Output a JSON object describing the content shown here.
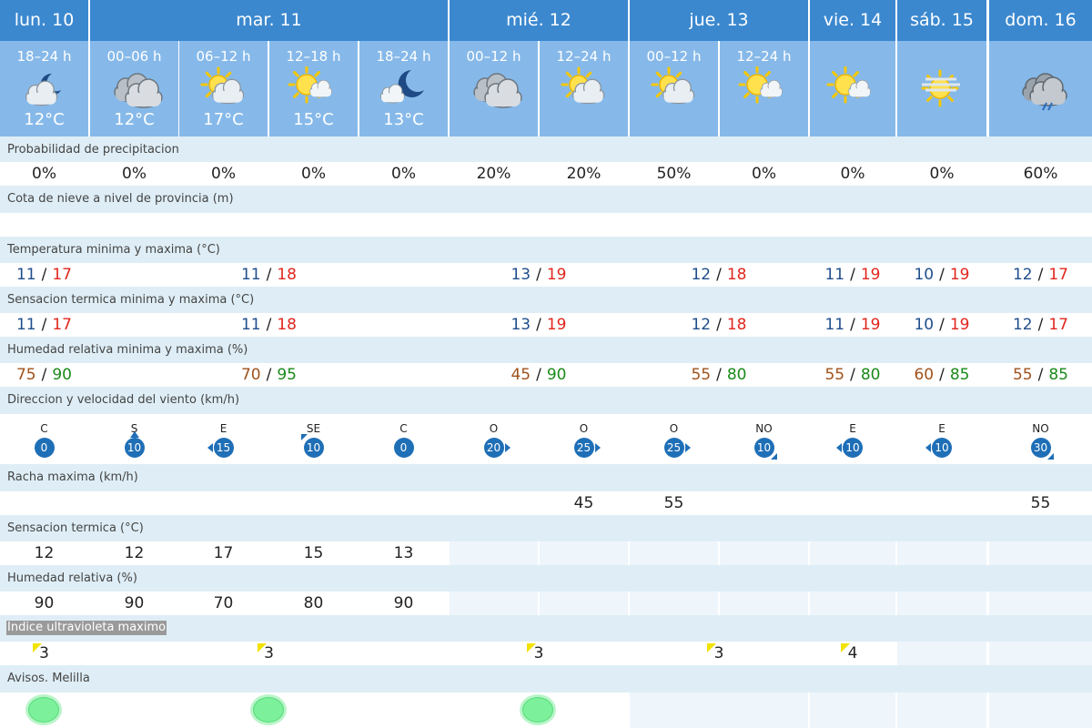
{
  "days": [
    "lun. 10",
    "mar. 11",
    "mié. 12",
    "jue. 13",
    "vie. 14",
    "sáb. 15",
    "dom. 16"
  ],
  "periods": [
    {
      "time": "18–24 h",
      "icon": "partly-cloudy-night-icon",
      "temp": "12°C"
    },
    {
      "time": "00–06 h",
      "icon": "cloudy-icon",
      "temp": "12°C"
    },
    {
      "time": "06–12 h",
      "icon": "partly-cloudy-day-icon",
      "temp": "17°C"
    },
    {
      "time": "12–18 h",
      "icon": "sun-few-clouds-icon",
      "temp": "15°C"
    },
    {
      "time": "18–24 h",
      "icon": "moon-cloud-icon",
      "temp": "13°C"
    },
    {
      "time": "00–12 h",
      "icon": "cloudy-icon",
      "temp": ""
    },
    {
      "time": "12–24 h",
      "icon": "partly-cloudy-day-icon",
      "temp": ""
    },
    {
      "time": "00–12 h",
      "icon": "partly-cloudy-day-icon",
      "temp": ""
    },
    {
      "time": "12–24 h",
      "icon": "sun-few-clouds-icon",
      "temp": ""
    },
    {
      "time": "",
      "icon": "sun-few-clouds-icon",
      "temp": ""
    },
    {
      "time": "",
      "icon": "sun-haze-icon",
      "temp": ""
    },
    {
      "time": "",
      "icon": "cloud-rain-icon",
      "temp": ""
    }
  ],
  "labels": {
    "precip": "Probabilidad de precipitacion",
    "snow": "Cota de nieve a nivel de provincia (m)",
    "temp": "Temperatura minima y maxima (°C)",
    "feels": "Sensacion termica minima y maxima (°C)",
    "humidity": "Humedad relativa minima y maxima (%)",
    "wind": "Direccion y velocidad del viento (km/h)",
    "gust": "Racha maxima (km/h)",
    "feels_single": "Sensacion termica (°C)",
    "humidity_single": "Humedad relativa (%)",
    "uv": "Indice ultravioleta maximo",
    "avisos": "Avisos. Melilla"
  },
  "precip": [
    "0%",
    "0%",
    "0%",
    "0%",
    "0%",
    "20%",
    "20%",
    "50%",
    "0%",
    "0%",
    "0%",
    "60%"
  ],
  "slash": "/",
  "temp": [
    {
      "min": "11",
      "max": "17"
    },
    {
      "min": "11",
      "max": "18"
    },
    {
      "min": "13",
      "max": "19"
    },
    {
      "min": "12",
      "max": "18"
    },
    {
      "min": "11",
      "max": "19"
    },
    {
      "min": "10",
      "max": "19"
    },
    {
      "min": "12",
      "max": "17"
    }
  ],
  "feels": [
    {
      "min": "11",
      "max": "17"
    },
    {
      "min": "11",
      "max": "18"
    },
    {
      "min": "13",
      "max": "19"
    },
    {
      "min": "12",
      "max": "18"
    },
    {
      "min": "11",
      "max": "19"
    },
    {
      "min": "10",
      "max": "19"
    },
    {
      "min": "12",
      "max": "17"
    }
  ],
  "humidity": [
    {
      "min": "75",
      "max": "90"
    },
    {
      "min": "70",
      "max": "95"
    },
    {
      "min": "45",
      "max": "90"
    },
    {
      "min": "55",
      "max": "80"
    },
    {
      "min": "55",
      "max": "80"
    },
    {
      "min": "60",
      "max": "85"
    },
    {
      "min": "55",
      "max": "85"
    }
  ],
  "wind": [
    {
      "dir": "C",
      "speed": "0",
      "arrow": "none"
    },
    {
      "dir": "S",
      "speed": "10",
      "arrow": "up"
    },
    {
      "dir": "E",
      "speed": "15",
      "arrow": "left"
    },
    {
      "dir": "SE",
      "speed": "10",
      "arrow": "up-left"
    },
    {
      "dir": "C",
      "speed": "0",
      "arrow": "none"
    },
    {
      "dir": "O",
      "speed": "20",
      "arrow": "right"
    },
    {
      "dir": "O",
      "speed": "25",
      "arrow": "right"
    },
    {
      "dir": "O",
      "speed": "25",
      "arrow": "right"
    },
    {
      "dir": "NO",
      "speed": "10",
      "arrow": "down-right"
    },
    {
      "dir": "E",
      "speed": "10",
      "arrow": "left"
    },
    {
      "dir": "E",
      "speed": "10",
      "arrow": "left"
    },
    {
      "dir": "NO",
      "speed": "30",
      "arrow": "down-right"
    }
  ],
  "gust": [
    "",
    "",
    "",
    "",
    "",
    "",
    "45",
    "55",
    "",
    "",
    "",
    "55"
  ],
  "feels_single": [
    "12",
    "12",
    "17",
    "15",
    "13"
  ],
  "humidity_single": [
    "90",
    "90",
    "70",
    "80",
    "90"
  ],
  "uv": [
    "3",
    "3",
    "3",
    "3",
    "4",
    "",
    ""
  ],
  "avisos": [
    "green",
    "green",
    "green",
    "",
    "",
    "",
    ""
  ],
  "colors": {
    "header_blue": "#3b88cf",
    "period_blue": "#86b9e9",
    "row_sep": "#dfeef6",
    "min_temp": "#1f4e8c",
    "max_temp": "#e0261d",
    "hum_min": "#a0521b",
    "hum_max": "#1a8a1a",
    "wind_badge": "#1f6fb7",
    "uv_flag": "#f2e200",
    "aviso_green": "#7cf09a"
  }
}
